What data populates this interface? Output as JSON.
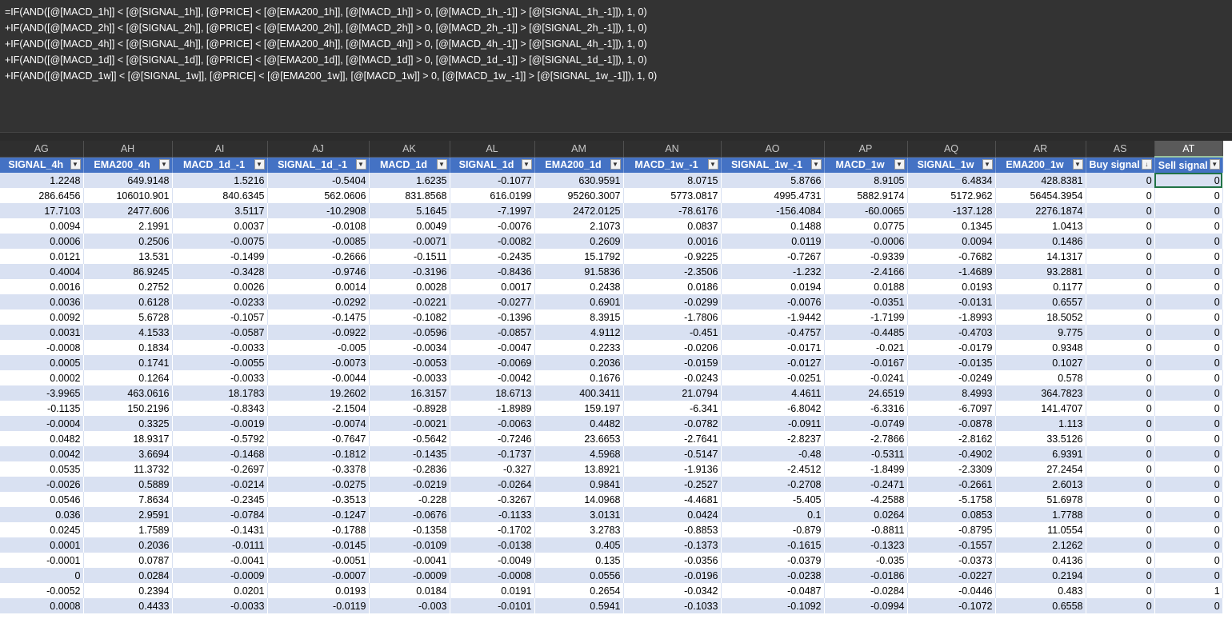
{
  "formula_bar": {
    "lines": [
      "=IF(AND([@[MACD_1h]] < [@[SIGNAL_1h]], [@PRICE] < [@[EMA200_1h]], [@[MACD_1h]] > 0, [@[MACD_1h_-1]] > [@[SIGNAL_1h_-1]]), 1, 0)",
      "+IF(AND([@[MACD_2h]] < [@[SIGNAL_2h]], [@PRICE] < [@[EMA200_2h]], [@[MACD_2h]] > 0, [@[MACD_2h_-1]] > [@[SIGNAL_2h_-1]]), 1, 0)",
      "+IF(AND([@[MACD_4h]] < [@[SIGNAL_4h]], [@PRICE] < [@[EMA200_4h]], [@[MACD_4h]] > 0, [@[MACD_4h_-1]] > [@[SIGNAL_4h_-1]]), 1, 0)",
      "+IF(AND([@[MACD_1d]] < [@[SIGNAL_1d]], [@PRICE] < [@[EMA200_1d]], [@[MACD_1d]] > 0, [@[MACD_1d_-1]] > [@[SIGNAL_1d_-1]]), 1, 0)",
      "+IF(AND([@[MACD_1w]] < [@[SIGNAL_1w]], [@PRICE] < [@[EMA200_1w]], [@[MACD_1w]] > 0, [@[MACD_1w_-1]] > [@[SIGNAL_1w_-1]]), 1, 0)"
    ]
  },
  "sheet": {
    "column_letters": [
      "AG",
      "AH",
      "AI",
      "AJ",
      "AK",
      "AL",
      "AM",
      "AN",
      "AO",
      "AP",
      "AQ",
      "AR",
      "AS",
      "AT"
    ],
    "selected_column": "AT",
    "headers": [
      "SIGNAL_4h",
      "EMA200_4h",
      "MACD_1d_-1",
      "SIGNAL_1d_-1",
      "MACD_1d",
      "SIGNAL_1d",
      "EMA200_1d",
      "MACD_1w_-1",
      "SIGNAL_1w_-1",
      "MACD_1w",
      "SIGNAL_1w",
      "EMA200_1w",
      "Buy signal",
      "Sell signal"
    ],
    "sorted_column_index": 12,
    "rows": [
      [
        "1.2248",
        "649.9148",
        "1.5216",
        "-0.5404",
        "1.6235",
        "-0.1077",
        "630.9591",
        "8.0715",
        "5.8766",
        "8.9105",
        "6.4834",
        "428.8381",
        "0",
        "0"
      ],
      [
        "286.6456",
        "106010.901",
        "840.6345",
        "562.0606",
        "831.8568",
        "616.0199",
        "95260.3007",
        "5773.0817",
        "4995.4731",
        "5882.9174",
        "5172.962",
        "56454.3954",
        "0",
        "0"
      ],
      [
        "17.7103",
        "2477.606",
        "3.5117",
        "-10.2908",
        "5.1645",
        "-7.1997",
        "2472.0125",
        "-78.6176",
        "-156.4084",
        "-60.0065",
        "-137.128",
        "2276.1874",
        "0",
        "0"
      ],
      [
        "0.0094",
        "2.1991",
        "0.0037",
        "-0.0108",
        "0.0049",
        "-0.0076",
        "2.1073",
        "0.0837",
        "0.1488",
        "0.0775",
        "0.1345",
        "1.0413",
        "0",
        "0"
      ],
      [
        "0.0006",
        "0.2506",
        "-0.0075",
        "-0.0085",
        "-0.0071",
        "-0.0082",
        "0.2609",
        "0.0016",
        "0.0119",
        "-0.0006",
        "0.0094",
        "0.1486",
        "0",
        "0"
      ],
      [
        "0.0121",
        "13.531",
        "-0.1499",
        "-0.2666",
        "-0.1511",
        "-0.2435",
        "15.1792",
        "-0.9225",
        "-0.7267",
        "-0.9339",
        "-0.7682",
        "14.1317",
        "0",
        "0"
      ],
      [
        "0.4004",
        "86.9245",
        "-0.3428",
        "-0.9746",
        "-0.3196",
        "-0.8436",
        "91.5836",
        "-2.3506",
        "-1.232",
        "-2.4166",
        "-1.4689",
        "93.2881",
        "0",
        "0"
      ],
      [
        "0.0016",
        "0.2752",
        "0.0026",
        "0.0014",
        "0.0028",
        "0.0017",
        "0.2438",
        "0.0186",
        "0.0194",
        "0.0188",
        "0.0193",
        "0.1177",
        "0",
        "0"
      ],
      [
        "0.0036",
        "0.6128",
        "-0.0233",
        "-0.0292",
        "-0.0221",
        "-0.0277",
        "0.6901",
        "-0.0299",
        "-0.0076",
        "-0.0351",
        "-0.0131",
        "0.6557",
        "0",
        "0"
      ],
      [
        "0.0092",
        "5.6728",
        "-0.1057",
        "-0.1475",
        "-0.1082",
        "-0.1396",
        "8.3915",
        "-1.7806",
        "-1.9442",
        "-1.7199",
        "-1.8993",
        "18.5052",
        "0",
        "0"
      ],
      [
        "0.0031",
        "4.1533",
        "-0.0587",
        "-0.0922",
        "-0.0596",
        "-0.0857",
        "4.9112",
        "-0.451",
        "-0.4757",
        "-0.4485",
        "-0.4703",
        "9.775",
        "0",
        "0"
      ],
      [
        "-0.0008",
        "0.1834",
        "-0.0033",
        "-0.005",
        "-0.0034",
        "-0.0047",
        "0.2233",
        "-0.0206",
        "-0.0171",
        "-0.021",
        "-0.0179",
        "0.9348",
        "0",
        "0"
      ],
      [
        "0.0005",
        "0.1741",
        "-0.0055",
        "-0.0073",
        "-0.0053",
        "-0.0069",
        "0.2036",
        "-0.0159",
        "-0.0127",
        "-0.0167",
        "-0.0135",
        "0.1027",
        "0",
        "0"
      ],
      [
        "0.0002",
        "0.1264",
        "-0.0033",
        "-0.0044",
        "-0.0033",
        "-0.0042",
        "0.1676",
        "-0.0243",
        "-0.0251",
        "-0.0241",
        "-0.0249",
        "0.578",
        "0",
        "0"
      ],
      [
        "-3.9965",
        "463.0616",
        "18.1783",
        "19.2602",
        "16.3157",
        "18.6713",
        "400.3411",
        "21.0794",
        "4.4611",
        "24.6519",
        "8.4993",
        "364.7823",
        "0",
        "0"
      ],
      [
        "-0.1135",
        "150.2196",
        "-0.8343",
        "-2.1504",
        "-0.8928",
        "-1.8989",
        "159.197",
        "-6.341",
        "-6.8042",
        "-6.3316",
        "-6.7097",
        "141.4707",
        "0",
        "0"
      ],
      [
        "-0.0004",
        "0.3325",
        "-0.0019",
        "-0.0074",
        "-0.0021",
        "-0.0063",
        "0.4482",
        "-0.0782",
        "-0.0911",
        "-0.0749",
        "-0.0878",
        "1.113",
        "0",
        "0"
      ],
      [
        "0.0482",
        "18.9317",
        "-0.5792",
        "-0.7647",
        "-0.5642",
        "-0.7246",
        "23.6653",
        "-2.7641",
        "-2.8237",
        "-2.7866",
        "-2.8162",
        "33.5126",
        "0",
        "0"
      ],
      [
        "0.0042",
        "3.6694",
        "-0.1468",
        "-0.1812",
        "-0.1435",
        "-0.1737",
        "4.5968",
        "-0.5147",
        "-0.48",
        "-0.5311",
        "-0.4902",
        "6.9391",
        "0",
        "0"
      ],
      [
        "0.0535",
        "11.3732",
        "-0.2697",
        "-0.3378",
        "-0.2836",
        "-0.327",
        "13.8921",
        "-1.9136",
        "-2.4512",
        "-1.8499",
        "-2.3309",
        "27.2454",
        "0",
        "0"
      ],
      [
        "-0.0026",
        "0.5889",
        "-0.0214",
        "-0.0275",
        "-0.0219",
        "-0.0264",
        "0.9841",
        "-0.2527",
        "-0.2708",
        "-0.2471",
        "-0.2661",
        "2.6013",
        "0",
        "0"
      ],
      [
        "0.0546",
        "7.8634",
        "-0.2345",
        "-0.3513",
        "-0.228",
        "-0.3267",
        "14.0968",
        "-4.4681",
        "-5.405",
        "-4.2588",
        "-5.1758",
        "51.6978",
        "0",
        "0"
      ],
      [
        "0.036",
        "2.9591",
        "-0.0784",
        "-0.1247",
        "-0.0676",
        "-0.1133",
        "3.0131",
        "0.0424",
        "0.1",
        "0.0264",
        "0.0853",
        "1.7788",
        "0",
        "0"
      ],
      [
        "0.0245",
        "1.7589",
        "-0.1431",
        "-0.1788",
        "-0.1358",
        "-0.1702",
        "3.2783",
        "-0.8853",
        "-0.879",
        "-0.8811",
        "-0.8795",
        "11.0554",
        "0",
        "0"
      ],
      [
        "0.0001",
        "0.2036",
        "-0.0111",
        "-0.0145",
        "-0.0109",
        "-0.0138",
        "0.405",
        "-0.1373",
        "-0.1615",
        "-0.1323",
        "-0.1557",
        "2.1262",
        "0",
        "0"
      ],
      [
        "-0.0001",
        "0.0787",
        "-0.0041",
        "-0.0051",
        "-0.0041",
        "-0.0049",
        "0.135",
        "-0.0356",
        "-0.0379",
        "-0.035",
        "-0.0373",
        "0.4136",
        "0",
        "0"
      ],
      [
        "0",
        "0.0284",
        "-0.0009",
        "-0.0007",
        "-0.0009",
        "-0.0008",
        "0.0556",
        "-0.0196",
        "-0.0238",
        "-0.0186",
        "-0.0227",
        "0.2194",
        "0",
        "0"
      ],
      [
        "-0.0052",
        "0.2394",
        "0.0201",
        "0.0193",
        "0.0184",
        "0.0191",
        "0.2654",
        "-0.0342",
        "-0.0487",
        "-0.0284",
        "-0.0446",
        "0.483",
        "0",
        "1"
      ],
      [
        "0.0008",
        "0.4433",
        "-0.0033",
        "-0.0119",
        "-0.003",
        "-0.0101",
        "0.5941",
        "-0.1033",
        "-0.1092",
        "-0.0994",
        "-0.1072",
        "0.6558",
        "0",
        "0"
      ]
    ]
  },
  "icons": {
    "filter_dropdown": "▼",
    "sort_filter_dropdown": "↓"
  }
}
